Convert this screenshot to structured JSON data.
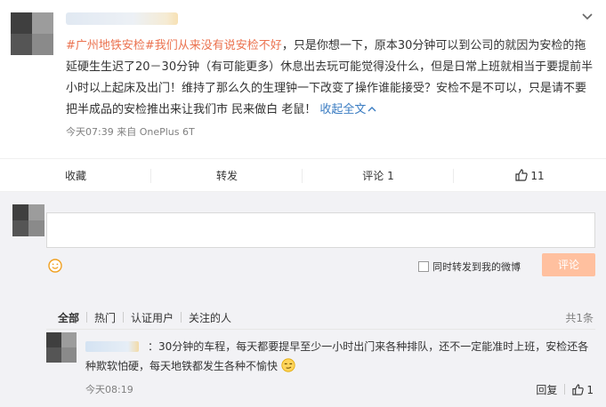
{
  "post": {
    "tag": "#广州地铁安检#",
    "link_text": "我们从来没有说安检不好",
    "body": "，只是你想一下，原本30分钟可以到公司的就因为安检的拖延硬生生迟了20－30分钟（有可能更多）休息出去玩可能觉得没什么，但是日常上班就相当于要提前半小时以上起床及出门！维持了那么久的生理钟一下改变了操作谁能接受？安检不是不可以，只是请不要把半成品的安检推出来让我们市 民来做白 老鼠！",
    "collapse_label": "收起全文",
    "meta": "今天07:39 来自 OnePlus 6T"
  },
  "actions": {
    "favorite": "收藏",
    "repost": "转发",
    "comment": "评论 1",
    "like_count": "11"
  },
  "composer": {
    "repost_label": "同时转发到我的微博",
    "submit_label": "评论"
  },
  "filters": {
    "all": "全部",
    "hot": "热门",
    "verified": "认证用户",
    "following": "关注的人",
    "total": "共1条"
  },
  "reply": {
    "text": "：30分钟的车程，每天都要提早至少一小时出门来各种排队，还不一定能准时上班，安检还各种欺软怕硬，每天地铁都发生各种不愉快",
    "time": "今天08:19",
    "reply_label": "回复",
    "like_count": "1"
  },
  "colors": {
    "accent": "#eb7350",
    "link": "#3a7cc2",
    "submit_disabled": "#ffc09f"
  }
}
